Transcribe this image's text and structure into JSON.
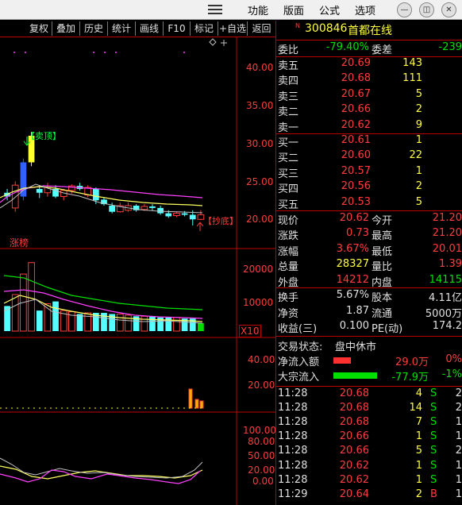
{
  "menu": {
    "features": "功能",
    "layout": "版面",
    "formula": "公式",
    "options": "选项"
  },
  "toolbar": [
    "复权",
    "叠加",
    "历史",
    "统计",
    "画线",
    "F10",
    "标记",
    "+自选",
    "返回"
  ],
  "stock": {
    "code": "300846",
    "name": "首都在线"
  },
  "wei": {
    "ratio_label": "委比",
    "ratio": "-79.40%",
    "diff_label": "委差",
    "diff": "-239"
  },
  "sells": [
    {
      "label": "卖五",
      "price": "20.69",
      "vol": "143"
    },
    {
      "label": "卖四",
      "price": "20.68",
      "vol": "111"
    },
    {
      "label": "卖三",
      "price": "20.67",
      "vol": "5"
    },
    {
      "label": "卖二",
      "price": "20.66",
      "vol": "2"
    },
    {
      "label": "卖一",
      "price": "20.62",
      "vol": "9"
    }
  ],
  "buys": [
    {
      "label": "买一",
      "price": "20.61",
      "vol": "1"
    },
    {
      "label": "买二",
      "price": "20.60",
      "vol": "22"
    },
    {
      "label": "买三",
      "price": "20.57",
      "vol": "1"
    },
    {
      "label": "买四",
      "price": "20.56",
      "vol": "2"
    },
    {
      "label": "买五",
      "price": "20.53",
      "vol": "5"
    }
  ],
  "quote": [
    {
      "l1": "现价",
      "v1": "20.62",
      "l2": "今开",
      "v2": "21.20",
      "c1": "r",
      "c2": "r"
    },
    {
      "l1": "涨跌",
      "v1": "0.73",
      "l2": "最高",
      "v2": "21.20",
      "c1": "r",
      "c2": "r"
    },
    {
      "l1": "涨幅",
      "v1": "3.67%",
      "l2": "最低",
      "v2": "20.01",
      "c1": "r",
      "c2": "r"
    },
    {
      "l1": "总量",
      "v1": "28327",
      "l2": "量比",
      "v2": "1.39",
      "c1": "y",
      "c2": "r"
    },
    {
      "l1": "外盘",
      "v1": "14212",
      "l2": "内盘",
      "v2": "14115",
      "c1": "r",
      "c2": "g"
    }
  ],
  "stats": [
    {
      "l1": "换手",
      "v1": "5.67%",
      "l2": "股本",
      "v2": "4.11亿"
    },
    {
      "l1": "净资",
      "v1": "1.87",
      "l2": "流通",
      "v2": "5000万"
    },
    {
      "l1": "收益(三)",
      "v1": "0.100",
      "l2": "PE(动)",
      "v2": "174.2"
    }
  ],
  "status": {
    "label": "交易状态:",
    "value": "盘中休市"
  },
  "flows": [
    {
      "label": "净流入额",
      "amount": "29.0万",
      "pct": "0%",
      "color": "#ff3030",
      "bar": 0.4
    },
    {
      "label": "大宗流入",
      "amount": "-77.9万",
      "pct": "-1%",
      "color": "#00e000",
      "bar": 1.0
    }
  ],
  "ticks": [
    {
      "t": "11:28",
      "p": "20.68",
      "v": "4",
      "d": "S",
      "n": "2"
    },
    {
      "t": "11:28",
      "p": "20.68",
      "v": "14",
      "d": "S",
      "n": "2"
    },
    {
      "t": "11:28",
      "p": "20.68",
      "v": "7",
      "d": "S",
      "n": "1"
    },
    {
      "t": "11:28",
      "p": "20.66",
      "v": "1",
      "d": "S",
      "n": "1"
    },
    {
      "t": "11:28",
      "p": "20.66",
      "v": "5",
      "d": "S",
      "n": "2"
    },
    {
      "t": "11:28",
      "p": "20.62",
      "v": "1",
      "d": "S",
      "n": "1"
    },
    {
      "t": "11:28",
      "p": "20.62",
      "v": "1",
      "d": "S",
      "n": "1"
    },
    {
      "t": "11:29",
      "p": "20.64",
      "v": "2",
      "d": "B",
      "n": "1"
    }
  ],
  "chart": {
    "price_axis": [
      "40.00",
      "35.00",
      "30.00",
      "25.00",
      "20.00"
    ],
    "vol_axis": [
      "20000",
      "10000"
    ],
    "vol_unit": "X10",
    "ind1_axis": [
      "40.00",
      "20.00"
    ],
    "ind2_axis": [
      "100.00",
      "80.00",
      "50.00",
      "20.00",
      "0.00"
    ],
    "sell_tag": "【卖顶】",
    "buy_tag": "【抄底】",
    "label_zhangbang": "涨榜"
  },
  "chart_data": {
    "type": "candlestick",
    "yrange": [
      17,
      43
    ],
    "candles": [
      [
        23.5,
        24.0,
        22.5,
        23.0
      ],
      [
        21.5,
        25.0,
        21.0,
        24.5
      ],
      [
        23.0,
        28.0,
        22.5,
        27.5
      ],
      [
        27.5,
        31.5,
        27.0,
        31.0
      ],
      [
        24.0,
        24.5,
        22.8,
        23.5
      ],
      [
        23.5,
        24.8,
        23.0,
        24.2
      ],
      [
        24.0,
        24.5,
        22.8,
        23.0
      ],
      [
        23.0,
        24.0,
        22.5,
        23.8
      ],
      [
        23.8,
        24.6,
        23.4,
        24.4
      ],
      [
        24.4,
        24.8,
        23.8,
        24.0
      ],
      [
        23.2,
        24.5,
        22.9,
        24.2
      ],
      [
        24.0,
        24.2,
        22.0,
        22.5
      ],
      [
        22.6,
        22.9,
        21.8,
        22.0
      ],
      [
        21.8,
        22.2,
        20.8,
        21.0
      ],
      [
        21.0,
        22.2,
        20.9,
        21.8
      ],
      [
        21.2,
        22.2,
        21.0,
        21.8
      ],
      [
        21.8,
        22.0,
        21.0,
        21.2
      ],
      [
        21.3,
        22.0,
        21.1,
        21.7
      ],
      [
        21.7,
        22.0,
        21.2,
        21.5
      ],
      [
        21.5,
        21.8,
        20.6,
        20.8
      ],
      [
        20.8,
        21.2,
        20.2,
        20.4
      ],
      [
        20.5,
        21.0,
        20.3,
        20.8
      ],
      [
        20.8,
        21.1,
        20.4,
        20.6
      ],
      [
        20.6,
        21.2,
        19.2,
        20.0
      ],
      [
        20.0,
        21.2,
        19.9,
        20.6
      ]
    ],
    "volume": [
      11000,
      16000,
      25000,
      30000,
      9000,
      12000,
      13000,
      9000,
      8500,
      7500,
      8000,
      8000,
      8000,
      7500,
      7500,
      7000,
      6500,
      6500,
      6500,
      6000,
      6000,
      6000,
      5500,
      5500,
      3500
    ]
  }
}
